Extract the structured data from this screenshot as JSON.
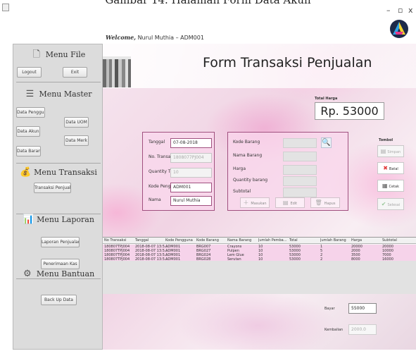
{
  "caption": "Gambar 14. Halaman Form Data Akun",
  "window": {
    "minimize": "–",
    "maximize": "▫",
    "close": "x"
  },
  "welcome": {
    "prefix": "Welcome,",
    "text": "Nurul Muthia – ADM001"
  },
  "sidebar": {
    "menu_file": {
      "title": "Menu File",
      "logout": "Logout",
      "exit": "Exit"
    },
    "menu_master": {
      "title": "Menu Master",
      "items": [
        "Data Pengguna",
        "Data UOM",
        "Data Akun",
        "Data Merk",
        "Data Barang"
      ]
    },
    "menu_transaksi": {
      "title": "Menu Transaksi",
      "items": [
        "Transaksi Penjualan"
      ]
    },
    "menu_laporan": {
      "title": "Menu Laporan",
      "items": [
        "Laporan Penjualan",
        "Penerimaan Kas"
      ]
    },
    "menu_bantuan": {
      "title": "Menu Bantuan",
      "items": [
        "Back Up Data"
      ]
    }
  },
  "header": {
    "title": "Form Transaksi Penjualan"
  },
  "total": {
    "label": "Total Harga",
    "value": "Rp. 53000"
  },
  "left_form": {
    "tanggal_label": "Tanggal",
    "tanggal_value": "07-08-2018",
    "no_transaksi_label": "No. Transaksi",
    "no_transaksi_value": "1808077PJ004",
    "qty_transaksi_label": "Quantity Transaksi",
    "qty_transaksi_value": "10",
    "kode_pengguna_label": "Kode Pengguna",
    "kode_pengguna_value": "ADM001",
    "nama_label": "Nama",
    "nama_value": "Nurul Muthia"
  },
  "right_form": {
    "kode_barang_label": "Kode Barang",
    "nama_barang_label": "Nama Barang",
    "harga_label": "Harga",
    "qty_barang_label": "Quantity barang",
    "subtotal_label": "Subtotal",
    "tambah": "Masukan",
    "edit": "Edit",
    "hapus": "Hapus"
  },
  "tombol": {
    "label": "Tombol",
    "simpan": "Simpan",
    "batal": "Batal",
    "cetak": "Cetak",
    "selesai": "Selesai"
  },
  "table": {
    "headers": [
      "No Transaksi",
      "Tanggal",
      "Kode Pengguna",
      "Kode Barang",
      "Nama Barang",
      "Jumlah Pemba...",
      "Total",
      "Jumlah Barang",
      "Harga",
      "Subtotal"
    ],
    "rows": [
      [
        "180807TPJ004",
        "2018-08-07 13:5...",
        "ADM001",
        "BRG007",
        "Crayons",
        "10",
        "53000",
        "1",
        "20000",
        "20000"
      ],
      [
        "180807TPJ004",
        "2018-08-07 13:5...",
        "ADM001",
        "BRG027",
        "Pulpen",
        "10",
        "53000",
        "5",
        "2000",
        "10000"
      ],
      [
        "180807TPJ004",
        "2018-08-07 13:5...",
        "ADM001",
        "BRG024",
        "Lem Glue",
        "10",
        "53000",
        "2",
        "3500",
        "7000"
      ],
      [
        "180807TPJ004",
        "2018-08-07 13:5...",
        "ADM001",
        "BRG028",
        "Serutan",
        "10",
        "53000",
        "2",
        "8000",
        "16000"
      ]
    ]
  },
  "payment": {
    "bayar_label": "Bayar",
    "bayar_value": "55000",
    "kembalian_label": "Kembalian",
    "kembalian_value": "2000.0"
  }
}
